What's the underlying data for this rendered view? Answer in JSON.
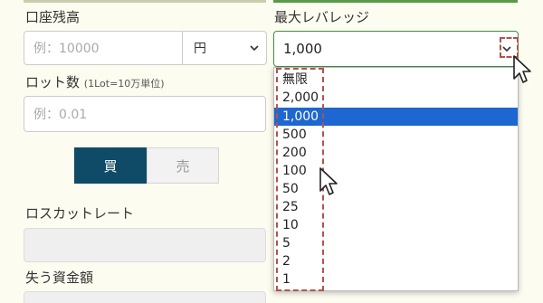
{
  "account": {
    "label": "口座残高",
    "placeholder": "例：10000",
    "currency": "円"
  },
  "leverage": {
    "label": "最大レバレッジ",
    "value": "1,000",
    "options": [
      "無限",
      "2,000",
      "1,000",
      "500",
      "200",
      "100",
      "50",
      "25",
      "10",
      "5",
      "2",
      "1"
    ],
    "selected_index": 2
  },
  "lot": {
    "label": "ロット数",
    "note": "(1Lot=10万単位)",
    "placeholder": "例：0.01"
  },
  "trade": {
    "buy": "買",
    "sell": "売"
  },
  "losscut": {
    "label": "ロスカットレート"
  },
  "loss_amount": {
    "label": "失う資金額"
  },
  "colors": {
    "buy_bg": "#0f4b66",
    "selected_option": "#1e66d0",
    "highlight_dash": "#b5524a",
    "focus_border": "#3f8f3f"
  }
}
